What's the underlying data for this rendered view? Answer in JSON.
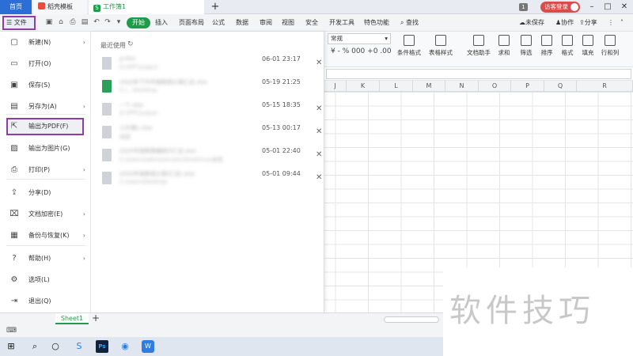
{
  "tabs": {
    "home": "首页",
    "template": "稻壳模板",
    "workbook": "工作簿1",
    "workbook_icon": "S"
  },
  "window": {
    "badge": "1",
    "visitor_login": "访客登录"
  },
  "ribbon": {
    "file_label": "文件",
    "menu_tabs": [
      "开始",
      "插入",
      "页面布局",
      "公式",
      "数据",
      "审阅",
      "视图",
      "安全",
      "开发工具",
      "特色功能"
    ],
    "search_label": "查找",
    "unsaved": "未保存",
    "collab": "协作",
    "share": "分享"
  },
  "toolbar": {
    "number_format": "常规",
    "format_row": "¥ - % 000 +0 .00",
    "tools": [
      "条件格式",
      "表格样式",
      "文档助手",
      "求和",
      "筛选",
      "排序",
      "格式",
      "填充",
      "行和列"
    ]
  },
  "grid": {
    "columns": [
      "J",
      "K",
      "L",
      "M",
      "N",
      "O",
      "P",
      "Q",
      "R"
    ]
  },
  "file_menu": {
    "items": [
      {
        "label": "新建(N)",
        "arrow": true
      },
      {
        "label": "打开(O)",
        "arrow": false
      },
      {
        "label": "保存(S)",
        "arrow": false
      },
      {
        "label": "另存为(A)",
        "arrow": true
      },
      {
        "label": "输出为PDF(F)",
        "arrow": false
      },
      {
        "label": "输出为图片(G)",
        "arrow": false
      },
      {
        "label": "打印(P)",
        "arrow": true
      },
      {
        "label": "分享(D)",
        "arrow": false
      },
      {
        "label": "文档加密(E)",
        "arrow": true
      },
      {
        "label": "备份与恢复(K)",
        "arrow": true
      },
      {
        "label": "帮助(H)",
        "arrow": true
      },
      {
        "label": "选项(L)",
        "arrow": false
      },
      {
        "label": "退出(Q)",
        "arrow": false
      }
    ]
  },
  "recent": {
    "title": "最近使用",
    "files": [
      {
        "name": "g.xlsx",
        "path": "D:\\PPT\\output",
        "date": "06-01 23:17",
        "green": false
      },
      {
        "name": "2020年下半年销售统计表汇总.xlsx",
        "path": "C:\\...\\Desktop",
        "date": "05-19 21:25",
        "green": true
      },
      {
        "name": "一个.xlsx",
        "path": "D:\\PPT\\output",
        "date": "05-15 18:35",
        "green": false
      },
      {
        "name": "工作簿1.xlsx",
        "path": "桌面",
        "date": "05-13 00:17",
        "green": false
      },
      {
        "name": "2020年销售数据统计汇总.xlsx",
        "path": "C:\\Users\\Administrator\\OneDrive\\桌面",
        "date": "05-01 22:40",
        "green": false
      },
      {
        "name": "2020年销售统计表(汇总).xlsx",
        "path": "C:\\Users\\Desktop",
        "date": "05-01 09:44",
        "green": false
      }
    ]
  },
  "sheet": {
    "tab": "Sheet1"
  },
  "taskbar": {
    "ps_label": "Ps",
    "wps_label": "W"
  },
  "watermark": "软件技巧"
}
